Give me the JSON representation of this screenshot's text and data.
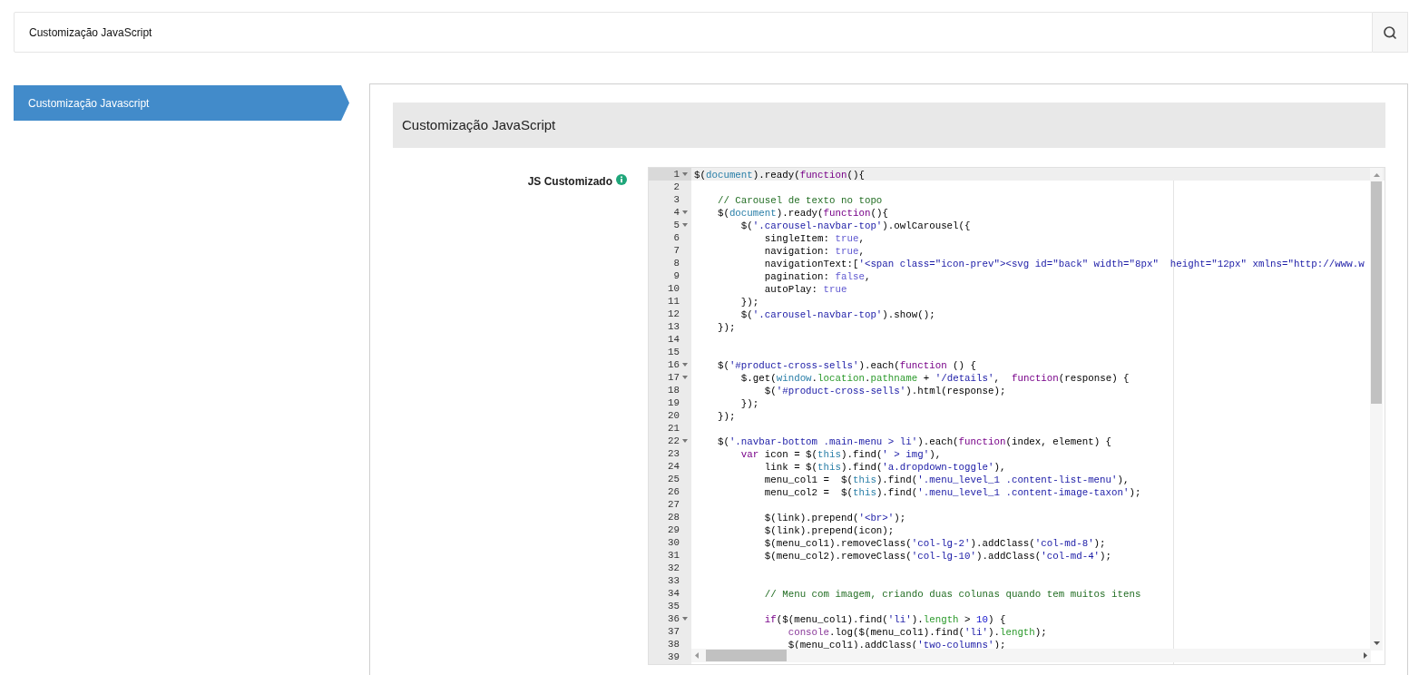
{
  "search": {
    "value": "Customização JavaScript"
  },
  "sidebar": {
    "items": [
      {
        "label": "Customização Javascript",
        "selected": true
      }
    ]
  },
  "panel": {
    "title": "Customização JavaScript",
    "field": {
      "label": "JS Customizado",
      "editor": {
        "lines": [
          {
            "number": "1",
            "fold": true,
            "active": true,
            "tokens": [
              {
                "kind": "plain",
                "text": "$("
              },
              {
                "kind": "variable",
                "text": "document"
              },
              {
                "kind": "plain",
                "text": ").ready("
              },
              {
                "kind": "keyword",
                "text": "function"
              },
              {
                "kind": "plain",
                "text": "(){"
              }
            ]
          },
          {
            "number": "2",
            "fold": false,
            "active": false
          },
          {
            "number": "3",
            "fold": false,
            "active": false,
            "tokens": [
              {
                "kind": "comment",
                "text": "    // Carousel de texto no topo"
              }
            ]
          },
          {
            "number": "4",
            "fold": true,
            "active": false,
            "tokens": [
              {
                "kind": "plain",
                "text": "    $("
              },
              {
                "kind": "variable",
                "text": "document"
              },
              {
                "kind": "plain",
                "text": ").ready("
              },
              {
                "kind": "keyword",
                "text": "function"
              },
              {
                "kind": "plain",
                "text": "(){"
              }
            ]
          },
          {
            "number": "5",
            "fold": true,
            "active": false,
            "tokens": [
              {
                "kind": "plain",
                "text": "        $("
              },
              {
                "kind": "string",
                "text": "'.carousel-navbar-top'"
              },
              {
                "kind": "plain",
                "text": ").owlCarousel({"
              }
            ]
          },
          {
            "number": "6",
            "fold": false,
            "active": false,
            "tokens": [
              {
                "kind": "plain",
                "text": "            singleItem: "
              },
              {
                "kind": "atom",
                "text": "true"
              },
              {
                "kind": "plain",
                "text": ","
              }
            ]
          },
          {
            "number": "7",
            "fold": false,
            "active": false,
            "tokens": [
              {
                "kind": "plain",
                "text": "            navigation: "
              },
              {
                "kind": "atom",
                "text": "true"
              },
              {
                "kind": "plain",
                "text": ","
              }
            ]
          },
          {
            "number": "8",
            "fold": false,
            "active": false,
            "tokens": [
              {
                "kind": "plain",
                "text": "            navigationText:["
              },
              {
                "kind": "string",
                "text": "'<span class=\"icon-prev\"><svg id=\"back\" width=\"8px\"  height=\"12px\" xmlns=\"http://www.w"
              }
            ]
          },
          {
            "number": "9",
            "fold": false,
            "active": false,
            "tokens": [
              {
                "kind": "plain",
                "text": "            pagination: "
              },
              {
                "kind": "atom",
                "text": "false"
              },
              {
                "kind": "plain",
                "text": ","
              }
            ]
          },
          {
            "number": "10",
            "fold": false,
            "active": false,
            "tokens": [
              {
                "kind": "plain",
                "text": "            autoPlay: "
              },
              {
                "kind": "atom",
                "text": "true"
              }
            ]
          },
          {
            "number": "11",
            "fold": false,
            "active": false,
            "tokens": [
              {
                "kind": "plain",
                "text": "        });"
              }
            ]
          },
          {
            "number": "12",
            "fold": false,
            "active": false,
            "tokens": [
              {
                "kind": "plain",
                "text": "        $("
              },
              {
                "kind": "string",
                "text": "'.carousel-navbar-top'"
              },
              {
                "kind": "plain",
                "text": ").show();"
              }
            ]
          },
          {
            "number": "13",
            "fold": false,
            "active": false,
            "tokens": [
              {
                "kind": "plain",
                "text": "    });"
              }
            ]
          },
          {
            "number": "14",
            "fold": false,
            "active": false
          },
          {
            "number": "15",
            "fold": false,
            "active": false
          },
          {
            "number": "16",
            "fold": true,
            "active": false,
            "tokens": [
              {
                "kind": "plain",
                "text": "    $("
              },
              {
                "kind": "string",
                "text": "'#product-cross-sells'"
              },
              {
                "kind": "plain",
                "text": ").each("
              },
              {
                "kind": "keyword",
                "text": "function"
              },
              {
                "kind": "plain",
                "text": " () {"
              }
            ]
          },
          {
            "number": "17",
            "fold": true,
            "active": false,
            "tokens": [
              {
                "kind": "plain",
                "text": "        $.get("
              },
              {
                "kind": "variable",
                "text": "window"
              },
              {
                "kind": "plain",
                "text": "."
              },
              {
                "kind": "property",
                "text": "location"
              },
              {
                "kind": "plain",
                "text": "."
              },
              {
                "kind": "property",
                "text": "pathname"
              },
              {
                "kind": "plain",
                "text": " + "
              },
              {
                "kind": "string",
                "text": "'/details'"
              },
              {
                "kind": "plain",
                "text": ",  "
              },
              {
                "kind": "keyword",
                "text": "function"
              },
              {
                "kind": "plain",
                "text": "(response) {"
              }
            ]
          },
          {
            "number": "18",
            "fold": false,
            "active": false,
            "tokens": [
              {
                "kind": "plain",
                "text": "            $("
              },
              {
                "kind": "string",
                "text": "'#product-cross-sells'"
              },
              {
                "kind": "plain",
                "text": ").html(response);"
              }
            ]
          },
          {
            "number": "19",
            "fold": false,
            "active": false,
            "tokens": [
              {
                "kind": "plain",
                "text": "        });"
              }
            ]
          },
          {
            "number": "20",
            "fold": false,
            "active": false,
            "tokens": [
              {
                "kind": "plain",
                "text": "    });"
              }
            ]
          },
          {
            "number": "21",
            "fold": false,
            "active": false
          },
          {
            "number": "22",
            "fold": true,
            "active": false,
            "tokens": [
              {
                "kind": "plain",
                "text": "    $("
              },
              {
                "kind": "string",
                "text": "'.navbar-bottom .main-menu > li'"
              },
              {
                "kind": "plain",
                "text": ").each("
              },
              {
                "kind": "keyword",
                "text": "function"
              },
              {
                "kind": "plain",
                "text": "(index, element) {"
              }
            ]
          },
          {
            "number": "23",
            "fold": false,
            "active": false,
            "tokens": [
              {
                "kind": "keyword",
                "text": "        var"
              },
              {
                "kind": "plain",
                "text": " icon = $("
              },
              {
                "kind": "variable",
                "text": "this"
              },
              {
                "kind": "plain",
                "text": ").find("
              },
              {
                "kind": "string",
                "text": "' > img'"
              },
              {
                "kind": "plain",
                "text": "),"
              }
            ]
          },
          {
            "number": "24",
            "fold": false,
            "active": false,
            "tokens": [
              {
                "kind": "plain",
                "text": "            link = $("
              },
              {
                "kind": "variable",
                "text": "this"
              },
              {
                "kind": "plain",
                "text": ").find("
              },
              {
                "kind": "string",
                "text": "'a.dropdown-toggle'"
              },
              {
                "kind": "plain",
                "text": "),"
              }
            ]
          },
          {
            "number": "25",
            "fold": false,
            "active": false,
            "tokens": [
              {
                "kind": "plain",
                "text": "            menu_col1 =  $("
              },
              {
                "kind": "variable",
                "text": "this"
              },
              {
                "kind": "plain",
                "text": ").find("
              },
              {
                "kind": "string",
                "text": "'.menu_level_1 .content-list-menu'"
              },
              {
                "kind": "plain",
                "text": "),"
              }
            ]
          },
          {
            "number": "26",
            "fold": false,
            "active": false,
            "tokens": [
              {
                "kind": "plain",
                "text": "            menu_col2 =  $("
              },
              {
                "kind": "variable",
                "text": "this"
              },
              {
                "kind": "plain",
                "text": ").find("
              },
              {
                "kind": "string",
                "text": "'.menu_level_1 .content-image-taxon'"
              },
              {
                "kind": "plain",
                "text": ");"
              }
            ]
          },
          {
            "number": "27",
            "fold": false,
            "active": false
          },
          {
            "number": "28",
            "fold": false,
            "active": false,
            "tokens": [
              {
                "kind": "plain",
                "text": "            $(link).prepend("
              },
              {
                "kind": "string",
                "text": "'<br>'"
              },
              {
                "kind": "plain",
                "text": ");"
              }
            ]
          },
          {
            "number": "29",
            "fold": false,
            "active": false,
            "tokens": [
              {
                "kind": "plain",
                "text": "            $(link).prepend(icon);"
              }
            ]
          },
          {
            "number": "30",
            "fold": false,
            "active": false,
            "tokens": [
              {
                "kind": "plain",
                "text": "            $(menu_col1).removeClass("
              },
              {
                "kind": "string",
                "text": "'col-lg-2'"
              },
              {
                "kind": "plain",
                "text": ").addClass("
              },
              {
                "kind": "string",
                "text": "'col-md-8'"
              },
              {
                "kind": "plain",
                "text": ");"
              }
            ]
          },
          {
            "number": "31",
            "fold": false,
            "active": false,
            "tokens": [
              {
                "kind": "plain",
                "text": "            $(menu_col2).removeClass("
              },
              {
                "kind": "string",
                "text": "'col-lg-10'"
              },
              {
                "kind": "plain",
                "text": ").addClass("
              },
              {
                "kind": "string",
                "text": "'col-md-4'"
              },
              {
                "kind": "plain",
                "text": ");"
              }
            ]
          },
          {
            "number": "32",
            "fold": false,
            "active": false
          },
          {
            "number": "33",
            "fold": false,
            "active": false
          },
          {
            "number": "34",
            "fold": false,
            "active": false,
            "tokens": [
              {
                "kind": "comment",
                "text": "            // Menu com imagem, criando duas colunas quando tem muitos itens"
              }
            ]
          },
          {
            "number": "35",
            "fold": false,
            "active": false
          },
          {
            "number": "36",
            "fold": true,
            "active": false,
            "tokens": [
              {
                "kind": "keyword",
                "text": "            if"
              },
              {
                "kind": "plain",
                "text": "($(menu_col1).find("
              },
              {
                "kind": "string",
                "text": "'li'"
              },
              {
                "kind": "plain",
                "text": ")."
              },
              {
                "kind": "property",
                "text": "length"
              },
              {
                "kind": "plain",
                "text": " > "
              },
              {
                "kind": "number",
                "text": "10"
              },
              {
                "kind": "plain",
                "text": ") {"
              }
            ]
          },
          {
            "number": "37",
            "fold": false,
            "active": false,
            "tokens": [
              {
                "kind": "builtin",
                "text": "                console"
              },
              {
                "kind": "plain",
                "text": ".log($(menu_col1).find("
              },
              {
                "kind": "string",
                "text": "'li'"
              },
              {
                "kind": "plain",
                "text": ")."
              },
              {
                "kind": "property",
                "text": "length"
              },
              {
                "kind": "plain",
                "text": ");"
              }
            ]
          },
          {
            "number": "38",
            "fold": false,
            "active": false,
            "tokens": [
              {
                "kind": "plain",
                "text": "                $(menu_col1).addClass("
              },
              {
                "kind": "string",
                "text": "'two-columns'"
              },
              {
                "kind": "plain",
                "text": ");"
              }
            ]
          },
          {
            "number": "39",
            "fold": false,
            "active": false
          }
        ]
      }
    }
  }
}
